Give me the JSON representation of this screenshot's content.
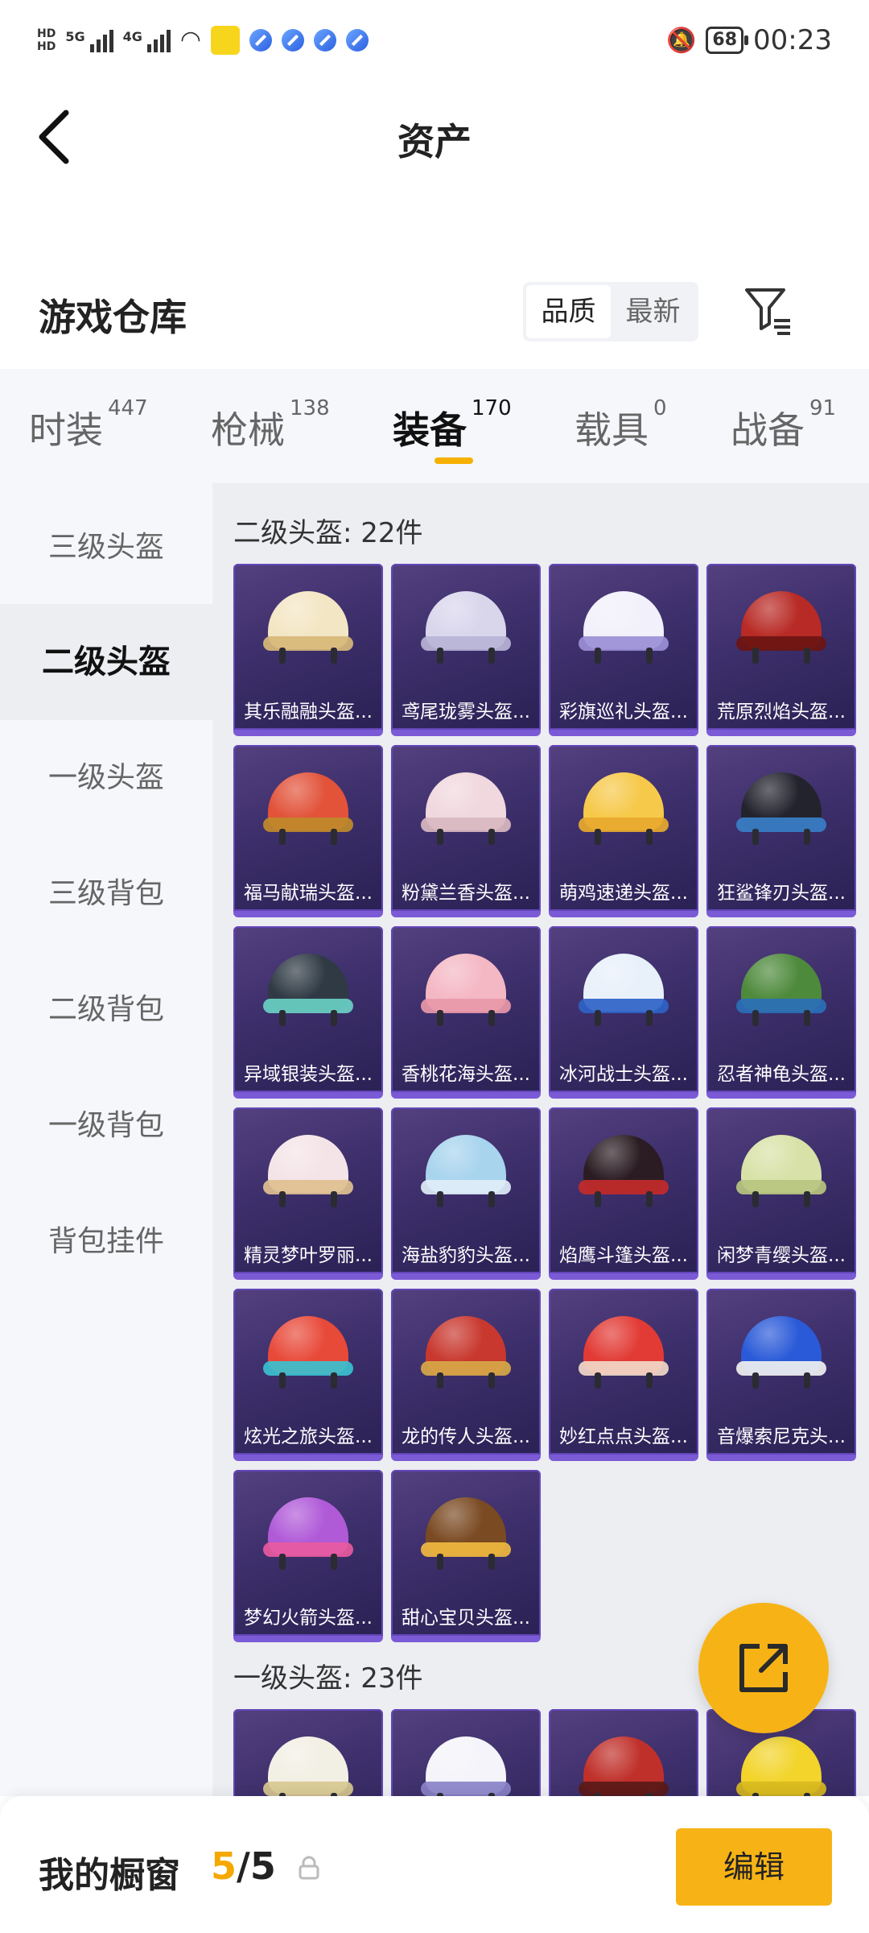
{
  "status_bar": {
    "net_top": "HD",
    "net_bottom": "HD",
    "sig1": "5G",
    "sig1_sub": "1",
    "sig2": "4G",
    "battery": "68",
    "time": "00:23"
  },
  "header": {
    "title": "资产",
    "back_icon": "chevron-left-icon"
  },
  "warehouse": {
    "title": "游戏仓库",
    "sort_options": [
      "品质",
      "最新"
    ],
    "active_sort": "品质"
  },
  "tabs": [
    {
      "label": "时装",
      "count": "447"
    },
    {
      "label": "枪械",
      "count": "138"
    },
    {
      "label": "装备",
      "count": "170",
      "active": true
    },
    {
      "label": "载具",
      "count": "0"
    },
    {
      "label": "战备",
      "count": "91"
    }
  ],
  "sidebar": [
    {
      "label": "三级头盔"
    },
    {
      "label": "二级头盔",
      "active": true
    },
    {
      "label": "一级头盔"
    },
    {
      "label": "三级背包"
    },
    {
      "label": "二级背包"
    },
    {
      "label": "一级背包"
    },
    {
      "label": "背包挂件"
    }
  ],
  "sections": [
    {
      "title": "二级头盔: 22件",
      "items": [
        {
          "name": "其乐融融头盔...",
          "color": "#f3e6c4",
          "rim": "#d8b978"
        },
        {
          "name": "鸢尾珑雾头盔...",
          "color": "#d9d6ec",
          "rim": "#b9b4d6"
        },
        {
          "name": "彩旗巡礼头盔...",
          "color": "#f2f0fa",
          "rim": "#9b8fd6"
        },
        {
          "name": "荒原烈焰头盔...",
          "color": "#b82a25",
          "rim": "#6b1512"
        },
        {
          "name": "福马献瑞头盔...",
          "color": "#e2533a",
          "rim": "#c08a2a"
        },
        {
          "name": "粉黛兰香头盔...",
          "color": "#f0d8de",
          "rim": "#d9b8c0"
        },
        {
          "name": "萌鸡速递头盔...",
          "color": "#f6c94a",
          "rim": "#e8a92e"
        },
        {
          "name": "狂鲨锋刃头盔...",
          "color": "#23232e",
          "rim": "#3a7fc8"
        },
        {
          "name": "异域银装头盔...",
          "color": "#2f3a44",
          "rim": "#6ad0c4"
        },
        {
          "name": "香桃花海头盔...",
          "color": "#f4b8c4",
          "rim": "#e898a8"
        },
        {
          "name": "冰河战士头盔...",
          "color": "#e8f0fa",
          "rim": "#2e63c8"
        },
        {
          "name": "忍者神龟头盔...",
          "color": "#4e8a3c",
          "rim": "#2a6fb8"
        },
        {
          "name": "精灵梦叶罗丽...",
          "color": "#f4e4e8",
          "rim": "#e0c090"
        },
        {
          "name": "海盐豹豹头盔...",
          "color": "#a8d4ee",
          "rim": "#dfeef8"
        },
        {
          "name": "焰鹰斗篷头盔...",
          "color": "#2a1c22",
          "rim": "#c42a2a"
        },
        {
          "name": "闲梦青缨头盔...",
          "color": "#d8e2a8",
          "rim": "#b8c680"
        },
        {
          "name": "炫光之旅头盔...",
          "color": "#e84a3a",
          "rim": "#3ac0d0"
        },
        {
          "name": "龙的传人头盔...",
          "color": "#c8382e",
          "rim": "#d8a848"
        },
        {
          "name": "妙红点点头盔...",
          "color": "#e23a34",
          "rim": "#f2d8c8"
        },
        {
          "name": "音爆索尼克头...",
          "color": "#2a5ad8",
          "rim": "#f0f0f0"
        },
        {
          "name": "梦幻火箭头盔...",
          "color": "#b05ad8",
          "rim": "#e85aa0"
        },
        {
          "name": "甜心宝贝头盔...",
          "color": "#7a4a22",
          "rim": "#f0b840"
        }
      ]
    },
    {
      "title": "一级头盔: 23件",
      "items": [
        {
          "name": "",
          "color": "#f2efe4",
          "rim": "#d8c890"
        },
        {
          "name": "",
          "color": "#f4f4fa",
          "rim": "#8a82c8"
        },
        {
          "name": "",
          "color": "#c0302a",
          "rim": "#5a1a18"
        },
        {
          "name": "",
          "color": "#f2d42a",
          "rim": "#d8b820"
        }
      ]
    }
  ],
  "fab": {
    "icon": "share-external-icon"
  },
  "bottom_bar": {
    "title": "我的橱窗",
    "count_current": "5",
    "count_sep": "/",
    "count_total": "5",
    "lock_icon": "lock-icon",
    "edit_label": "编辑"
  }
}
